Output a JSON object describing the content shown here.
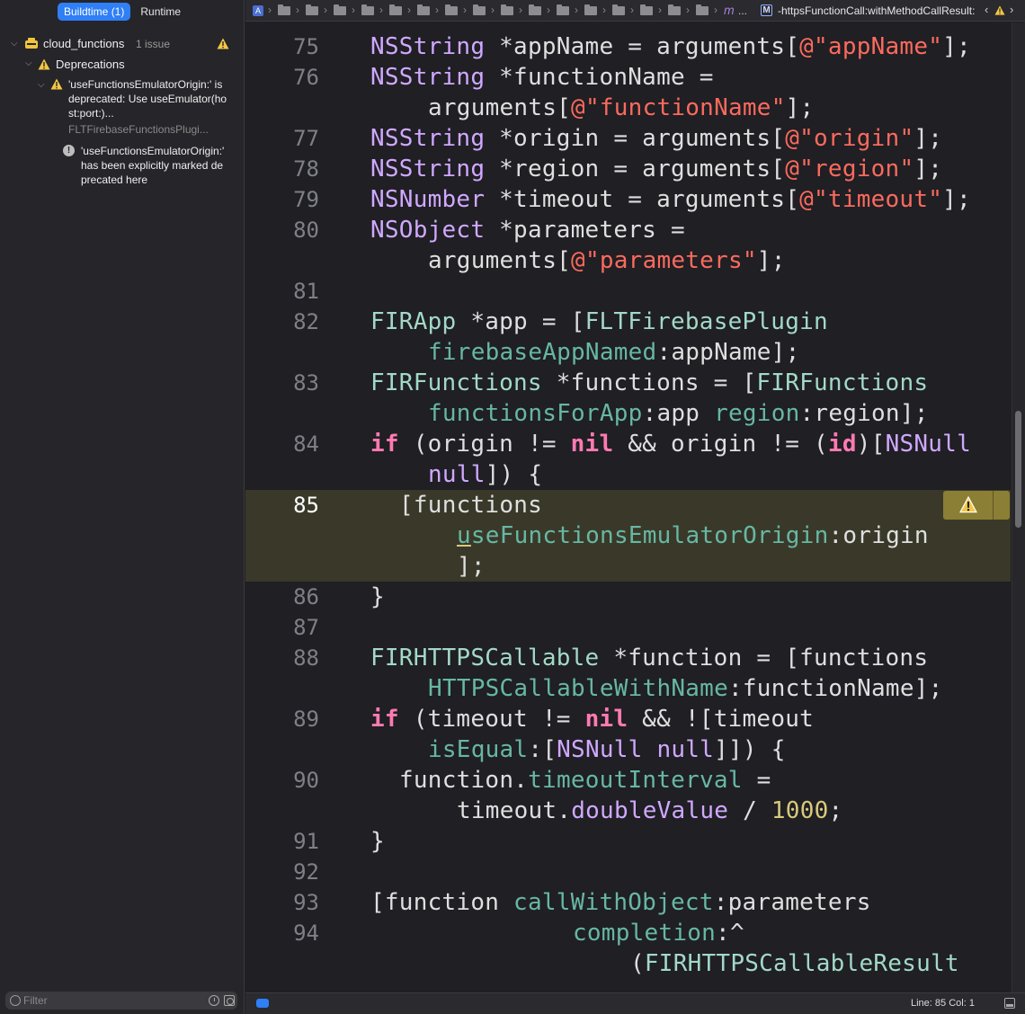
{
  "navigator": {
    "tabs": [
      {
        "label": "Buildtime (1)",
        "active": true
      },
      {
        "label": "Runtime",
        "active": false
      }
    ],
    "project": {
      "name": "cloud_functions",
      "issue_count": "1 issue"
    },
    "group": {
      "label": "Deprecations"
    },
    "issue": {
      "message": "'useFunctionsEmulatorOrigin:' is deprecated: Use useEmulator(host:port:)...",
      "file": "FLTFirebaseFunctionsPlugi...",
      "note": "'useFunctionsEmulatorOrigin:' has been explicitly marked deprecated here"
    },
    "filter": {
      "placeholder": "Filter"
    }
  },
  "jumpbar": {
    "ellipsis": "...",
    "method_icon_letter": "M",
    "method": "-httpsFunctionCall:withMethodCallResult:"
  },
  "editor": {
    "current_line": "85",
    "lines": [
      {
        "n": "75"
      },
      {
        "n": "76"
      },
      {
        "n": "77"
      },
      {
        "n": "78"
      },
      {
        "n": "79"
      },
      {
        "n": "80"
      },
      {
        "n": "81"
      },
      {
        "n": "82"
      },
      {
        "n": "83"
      },
      {
        "n": "84"
      },
      {
        "n": "85"
      },
      {
        "n": "86"
      },
      {
        "n": "87"
      },
      {
        "n": "88"
      },
      {
        "n": "89"
      },
      {
        "n": "90"
      },
      {
        "n": "91"
      },
      {
        "n": "92"
      },
      {
        "n": "93"
      },
      {
        "n": "94"
      }
    ],
    "code": [
      [
        [
          "type",
          "NSString"
        ],
        [
          "p",
          " *appName = arguments["
        ],
        [
          "str",
          "@\"appName\""
        ],
        [
          "p",
          "];"
        ]
      ],
      [
        [
          "type",
          "NSString"
        ],
        [
          "p",
          " *functionName ="
        ]
      ],
      [
        [
          "p",
          "arguments["
        ],
        [
          "str",
          "@\"functionName\""
        ],
        [
          "p",
          "];"
        ]
      ],
      [
        [
          "type",
          "NSString"
        ],
        [
          "p",
          " *origin = arguments["
        ],
        [
          "str",
          "@\"origin\""
        ],
        [
          "p",
          "];"
        ]
      ],
      [
        [
          "type",
          "NSString"
        ],
        [
          "p",
          " *region = arguments["
        ],
        [
          "str",
          "@\"region\""
        ],
        [
          "p",
          "];"
        ]
      ],
      [
        [
          "type",
          "NSNumber"
        ],
        [
          "p",
          " *timeout = arguments["
        ],
        [
          "str",
          "@\"timeout\""
        ],
        [
          "p",
          "];"
        ]
      ],
      [
        [
          "type",
          "NSObject"
        ],
        [
          "p",
          " *parameters ="
        ]
      ],
      [
        [
          "p",
          "arguments["
        ],
        [
          "str",
          "@\"parameters\""
        ],
        [
          "p",
          "];"
        ]
      ],
      [
        [
          "cls",
          "FIRApp"
        ],
        [
          "p",
          " *app = ["
        ],
        [
          "cls",
          "FLTFirebasePlugin"
        ]
      ],
      [
        [
          "meth",
          "firebaseAppNamed"
        ],
        [
          "p",
          ":appName];"
        ]
      ],
      [
        [
          "cls",
          "FIRFunctions"
        ],
        [
          "p",
          " *functions = ["
        ],
        [
          "cls",
          "FIRFunctions"
        ]
      ],
      [
        [
          "meth",
          "functionsForApp"
        ],
        [
          "p",
          ":app "
        ],
        [
          "meth",
          "region"
        ],
        [
          "p",
          ":region];"
        ]
      ],
      [
        [
          "kw",
          "if"
        ],
        [
          "p",
          " (origin != "
        ],
        [
          "kw",
          "nil"
        ],
        [
          "p",
          " && origin != ("
        ],
        [
          "kw",
          "id"
        ],
        [
          "p",
          ")["
        ],
        [
          "type",
          "NSNull"
        ]
      ],
      [
        [
          "type",
          "null"
        ],
        [
          "p",
          "]) {"
        ]
      ],
      [
        [
          "p",
          "[functions"
        ]
      ],
      [
        [
          "dep",
          "u"
        ],
        [
          "meth",
          "seFunctionsEmulatorOrigin"
        ],
        [
          "p",
          ":origin"
        ]
      ],
      [
        [
          "p",
          "];"
        ]
      ],
      [
        [
          "p",
          "}"
        ]
      ],
      [
        [
          "cls",
          "FIRHTTPSCallable"
        ],
        [
          "p",
          " *function = [functions"
        ]
      ],
      [
        [
          "meth",
          "HTTPSCallableWithName"
        ],
        [
          "p",
          ":functionName];"
        ]
      ],
      [
        [
          "kw",
          "if"
        ],
        [
          "p",
          " (timeout != "
        ],
        [
          "kw",
          "nil"
        ],
        [
          "p",
          " && ![timeout"
        ]
      ],
      [
        [
          "meth",
          "isEqual"
        ],
        [
          "p",
          ":["
        ],
        [
          "type",
          "NSNull"
        ],
        [
          "p",
          " "
        ],
        [
          "type",
          "null"
        ],
        [
          "p",
          "]]) {"
        ]
      ],
      [
        [
          "p",
          "function."
        ],
        [
          "meth",
          "timeoutInterval"
        ],
        [
          "p",
          " ="
        ]
      ],
      [
        [
          "p",
          "timeout."
        ],
        [
          "type",
          "doubleValue"
        ],
        [
          "p",
          " / "
        ],
        [
          "num",
          "1000"
        ],
        [
          "p",
          ";"
        ]
      ],
      [
        [
          "p",
          "}"
        ]
      ],
      [
        [
          "p",
          "[function "
        ],
        [
          "meth",
          "callWithObject"
        ],
        [
          "p",
          ":parameters"
        ]
      ],
      [
        [
          "meth",
          "completion"
        ],
        [
          "p",
          ":^"
        ]
      ],
      [
        [
          "p",
          "("
        ],
        [
          "cls",
          "FIRHTTPSCallableResult"
        ]
      ]
    ]
  },
  "statusbar": {
    "position": "Line: 85  Col: 1"
  }
}
